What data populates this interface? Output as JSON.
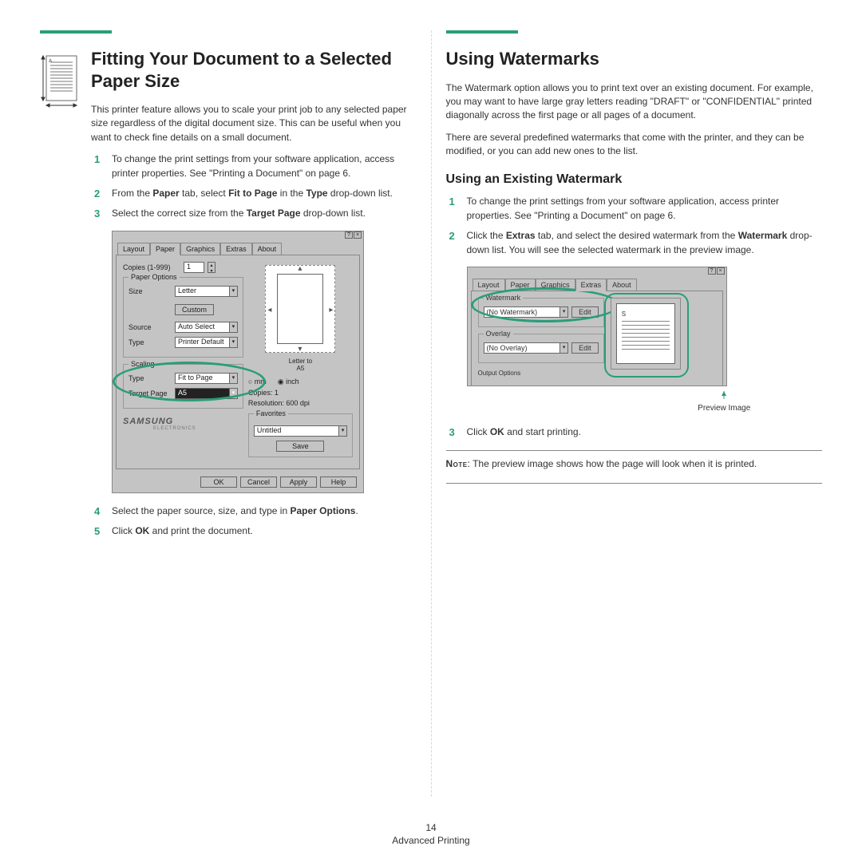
{
  "footer": {
    "page_number": "14",
    "section": "Advanced Printing"
  },
  "left": {
    "heading": "Fitting Your Document to a Selected Paper Size",
    "intro": "This printer feature allows you to scale your print job to any selected paper size regardless of the digital document size. This can be useful when you want to check fine details on a small document.",
    "steps": {
      "s1": "To change the print settings from your software application, access printer properties. See \"Printing a Document\" on page 6.",
      "s2_a": "From the ",
      "s2_b_bold": "Paper",
      "s2_c": " tab, select ",
      "s2_d_bold": "Fit to Page",
      "s2_e": " in the ",
      "s2_f_bold": "Type",
      "s2_g": " drop-down list.",
      "s3_a": "Select the correct size from the ",
      "s3_b_bold": "Target Page",
      "s3_c": " drop-down list.",
      "s4_a": "Select the paper source, size, and type in ",
      "s4_b_bold": "Paper Options",
      "s4_c": ".",
      "s5_a": "Click ",
      "s5_b_bold": "OK",
      "s5_c": " and print the document."
    },
    "dialog": {
      "tabs": {
        "layout": "Layout",
        "paper": "Paper",
        "graphics": "Graphics",
        "extras": "Extras",
        "about": "About"
      },
      "copies_label": "Copies (1-999)",
      "copies_value": "1",
      "paper_options": "Paper Options",
      "size_label": "Size",
      "size_value": "Letter",
      "custom_btn": "Custom",
      "source_label": "Source",
      "source_value": "Auto Select",
      "type_label": "Type",
      "type_value": "Printer Default",
      "scaling": "Scaling",
      "scale_type_label": "Type",
      "scale_type_value": "Fit to Page",
      "target_label": "Target Page",
      "target_value": "A5",
      "brand": "SAMSUNG",
      "brand_sub": "ELECTRONICS",
      "preview_caption_a": "Letter to",
      "preview_caption_b": "A5",
      "unit_mm": "mm",
      "unit_inch": "inch",
      "info_copies": "Copies: 1",
      "info_res": "Resolution: 600 dpi",
      "favorites": "Favorites",
      "fav_value": "Untitled",
      "save": "Save",
      "ok": "OK",
      "cancel": "Cancel",
      "apply": "Apply",
      "help": "Help"
    }
  },
  "right": {
    "heading": "Using Watermarks",
    "p1": "The Watermark option allows you to print text over an existing document. For example, you may want to have large gray letters reading \"DRAFT\" or \"CONFIDENTIAL\" printed diagonally across the first page or all pages of a document.",
    "p2": "There are several predefined watermarks that come with the printer, and they can be modified, or you can add new ones to the list.",
    "subheading": "Using an Existing Watermark",
    "steps": {
      "s1": "To change the print settings from your software application, access printer properties. See \"Printing a Document\" on page 6.",
      "s2_a": "Click the ",
      "s2_b_bold": "Extras",
      "s2_c": " tab, and select the desired watermark from the ",
      "s2_d_bold": "Watermark",
      "s2_e": " drop-down list. You will see the selected watermark in the preview image.",
      "s3_a": "Click ",
      "s3_b_bold": "OK",
      "s3_c": " and start printing."
    },
    "dialog": {
      "tabs": {
        "layout": "Layout",
        "paper": "Paper",
        "graphics": "Graphics",
        "extras": "Extras",
        "about": "About"
      },
      "watermark": "Watermark",
      "wm_value": "(No Watermark)",
      "edit": "Edit",
      "overlay": "Overlay",
      "ov_value": "(No Overlay)",
      "output": "Output Options",
      "preview_label": "Preview Image",
      "s_letter": "S"
    },
    "note_label": "Note",
    "note_text": ": The preview image shows how the page will look when it is printed."
  }
}
